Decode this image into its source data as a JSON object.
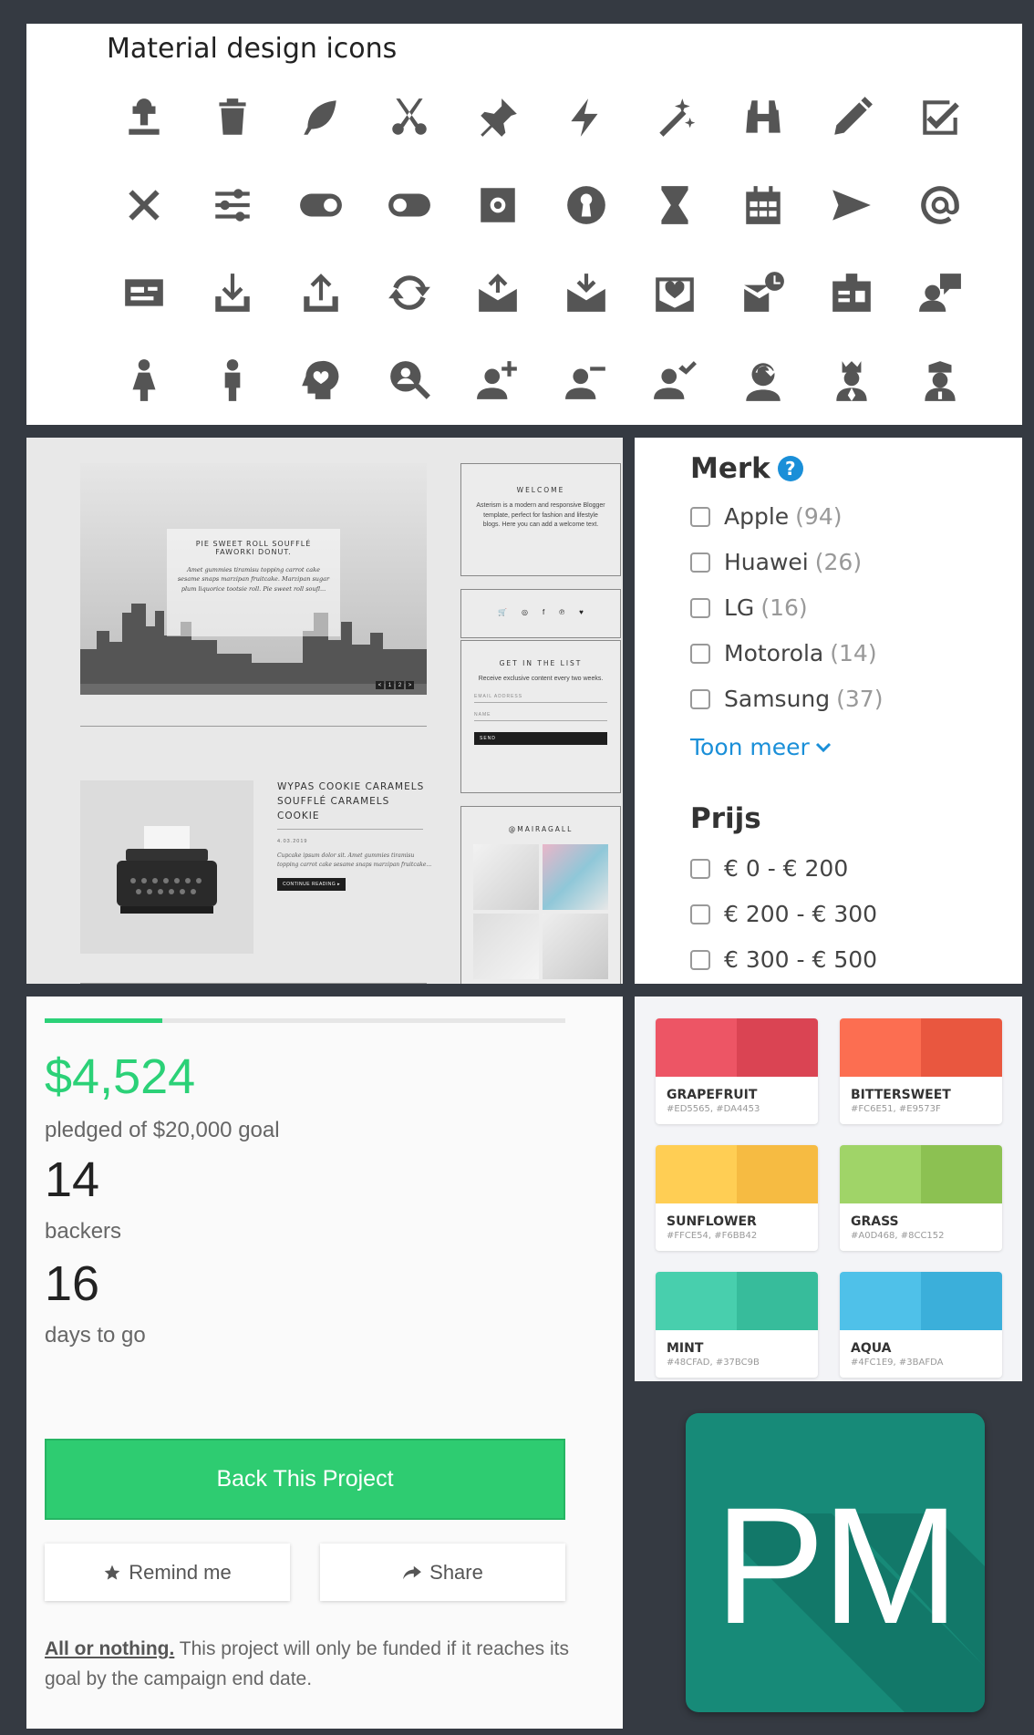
{
  "icons_panel": {
    "title": "Material design icons",
    "icons": [
      "tree-stump-icon",
      "trash-can-icon",
      "feather-icon",
      "scissors-icon",
      "pin-icon",
      "lightning-bolt-icon",
      "magic-wand-icon",
      "binoculars-icon",
      "pencil-icon",
      "checkbox-icon",
      "close-icon",
      "sliders-icon",
      "toggle-on-icon",
      "toggle-off-icon",
      "settings-square-icon",
      "keyhole-icon",
      "hourglass-icon",
      "calendar-icon",
      "send-icon",
      "at-sign-icon",
      "id-card-icon",
      "download-icon",
      "upload-icon",
      "sync-icon",
      "mail-upload-icon",
      "mail-download-icon",
      "mail-heart-icon",
      "mail-clock-icon",
      "badge-icon",
      "user-chat-icon",
      "female-icon",
      "male-icon",
      "head-heart-icon",
      "search-person-icon",
      "add-user-icon",
      "remove-user-icon",
      "user-check-icon",
      "user-sync-icon",
      "king-icon",
      "police-officer-icon"
    ]
  },
  "blog_panel": {
    "hero_title": "PIE SWEET ROLL SOUFFLÉ FAWORKI DONUT.",
    "hero_text": "Amet gummies tiramisu topping carrot cake sesame snaps marzipan fruitcake. Marzipan sugar plum liquorice tootsie roll. Pie sweet roll soufl...",
    "hero_nav": [
      "<",
      "1",
      "2",
      ">"
    ],
    "post_title": "WYPAS COOKIE CARAMELS SOUFFLÉ CARAMELS COOKIE",
    "post_date": "4.03.2019",
    "post_text": "Cupcake ipsum dolor sit. Amet gummies tiramisu topping carrot cake sesame snaps marzipan fruitcake...",
    "post_button": "CONTINUE READING ▸",
    "welcome_title": "WELCOME",
    "welcome_text": "Asterism is a modern and responsive Blogger template, perfect for fashion and lifestyle blogs. Here you can add a welcome text.",
    "social_icons": [
      "🛒",
      "◎",
      "f",
      "℗",
      "♥"
    ],
    "list_title": "GET IN THE LIST",
    "list_text": "Receive exclusive content every two weeks.",
    "email_placeholder": "EMAIL ADDRESS",
    "name_placeholder": "NAME",
    "send_label": "SEND",
    "insta_title": "@MAIRAGALL"
  },
  "filter_panel": {
    "brand_heading": "Merk",
    "help_label": "?",
    "brands": [
      {
        "name": "Apple",
        "count": "(94)"
      },
      {
        "name": "Huawei",
        "count": "(26)"
      },
      {
        "name": "LG",
        "count": "(16)"
      },
      {
        "name": "Motorola",
        "count": "(14)"
      },
      {
        "name": "Samsung",
        "count": "(37)"
      }
    ],
    "more_label": "Toon meer",
    "price_heading": "Prijs",
    "prices": [
      "€ 0 - € 200",
      "€ 200 - € 300",
      "€ 300 - € 500"
    ]
  },
  "campaign": {
    "progress_fraction": 0.2262,
    "amount": "$4,524",
    "pledged_label": "pledged of $20,000 goal",
    "backers": "14",
    "backers_label": "backers",
    "days": "16",
    "days_label": "days to go",
    "back_label": "Back This Project",
    "remind_label": "Remind me",
    "share_label": "Share",
    "note_bold": "All or nothing.",
    "note_text": " This project will only be funded if it reaches its goal by the campaign end date.",
    "accent_color": "#2ECC71"
  },
  "palette": [
    {
      "name": "GRAPEFRUIT",
      "hex": "#ED5565, #DA4453",
      "c1": "#ED5565",
      "c2": "#DA4453"
    },
    {
      "name": "BITTERSWEET",
      "hex": "#FC6E51, #E9573F",
      "c1": "#FC6E51",
      "c2": "#E9573F"
    },
    {
      "name": "SUNFLOWER",
      "hex": "#FFCE54, #F6BB42",
      "c1": "#FFCE54",
      "c2": "#F6BB42"
    },
    {
      "name": "GRASS",
      "hex": "#A0D468, #8CC152",
      "c1": "#A0D468",
      "c2": "#8CC152"
    },
    {
      "name": "MINT",
      "hex": "#48CFAD, #37BC9B",
      "c1": "#48CFAD",
      "c2": "#37BC9B"
    },
    {
      "name": "AQUA",
      "hex": "#4FC1E9, #3BAFDA",
      "c1": "#4FC1E9",
      "c2": "#3BAFDA"
    }
  ],
  "logo": {
    "text": "PM",
    "color": "#178A78"
  }
}
